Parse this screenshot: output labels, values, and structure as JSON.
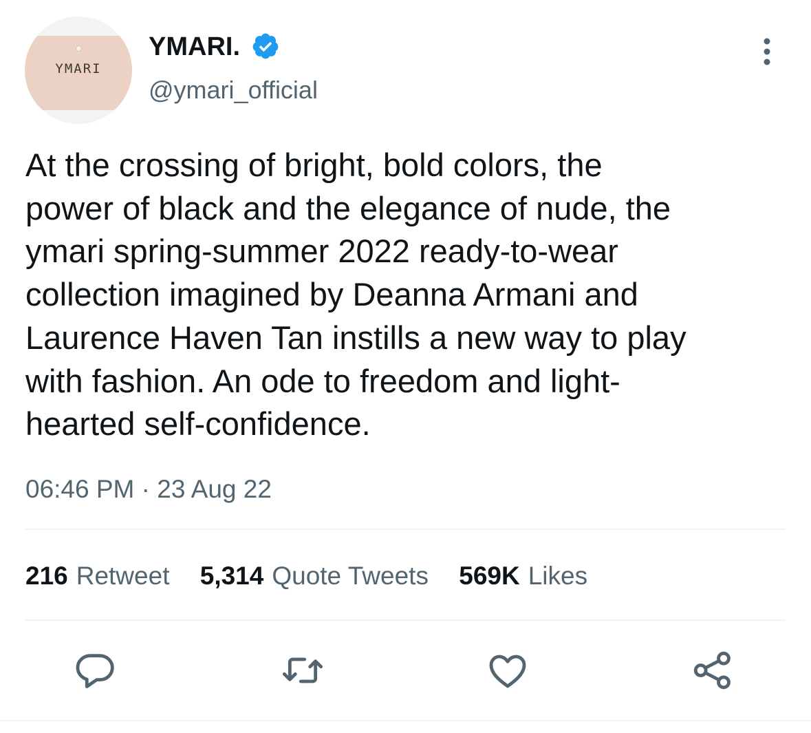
{
  "author": {
    "display_name": "YMARI.",
    "handle": "@ymari_official",
    "avatar_text": "YMARI",
    "verified": true
  },
  "tweet": {
    "text_lines": [
      "At the crossing of bright, bold colors, the",
      "power of black and the elegance of nude, the",
      "ymari spring-summer 2022 ready-to-wear",
      "collection imagined by Deanna Armani and",
      "Laurence Haven Tan instills a new way to play",
      "with fashion. An ode to freedom and light-",
      "hearted self-confidence."
    ],
    "time": "06:46 PM",
    "separator": "·",
    "date": "23 Aug 22"
  },
  "stats": {
    "retweets": {
      "count": "216",
      "label": "Retweet"
    },
    "quotes": {
      "count": "5,314",
      "label": "Quote Tweets"
    },
    "likes": {
      "count": "569K",
      "label": "Likes"
    }
  },
  "icons": {
    "verified": "verified-badge-icon",
    "more": "more-vertical-icon",
    "reply": "reply-icon",
    "retweet": "retweet-icon",
    "like": "heart-icon",
    "share": "share-icon"
  },
  "colors": {
    "text_primary": "#0f1419",
    "text_secondary": "#536471",
    "verified_blue": "#1d9bf0",
    "divider": "#eff3f4"
  }
}
